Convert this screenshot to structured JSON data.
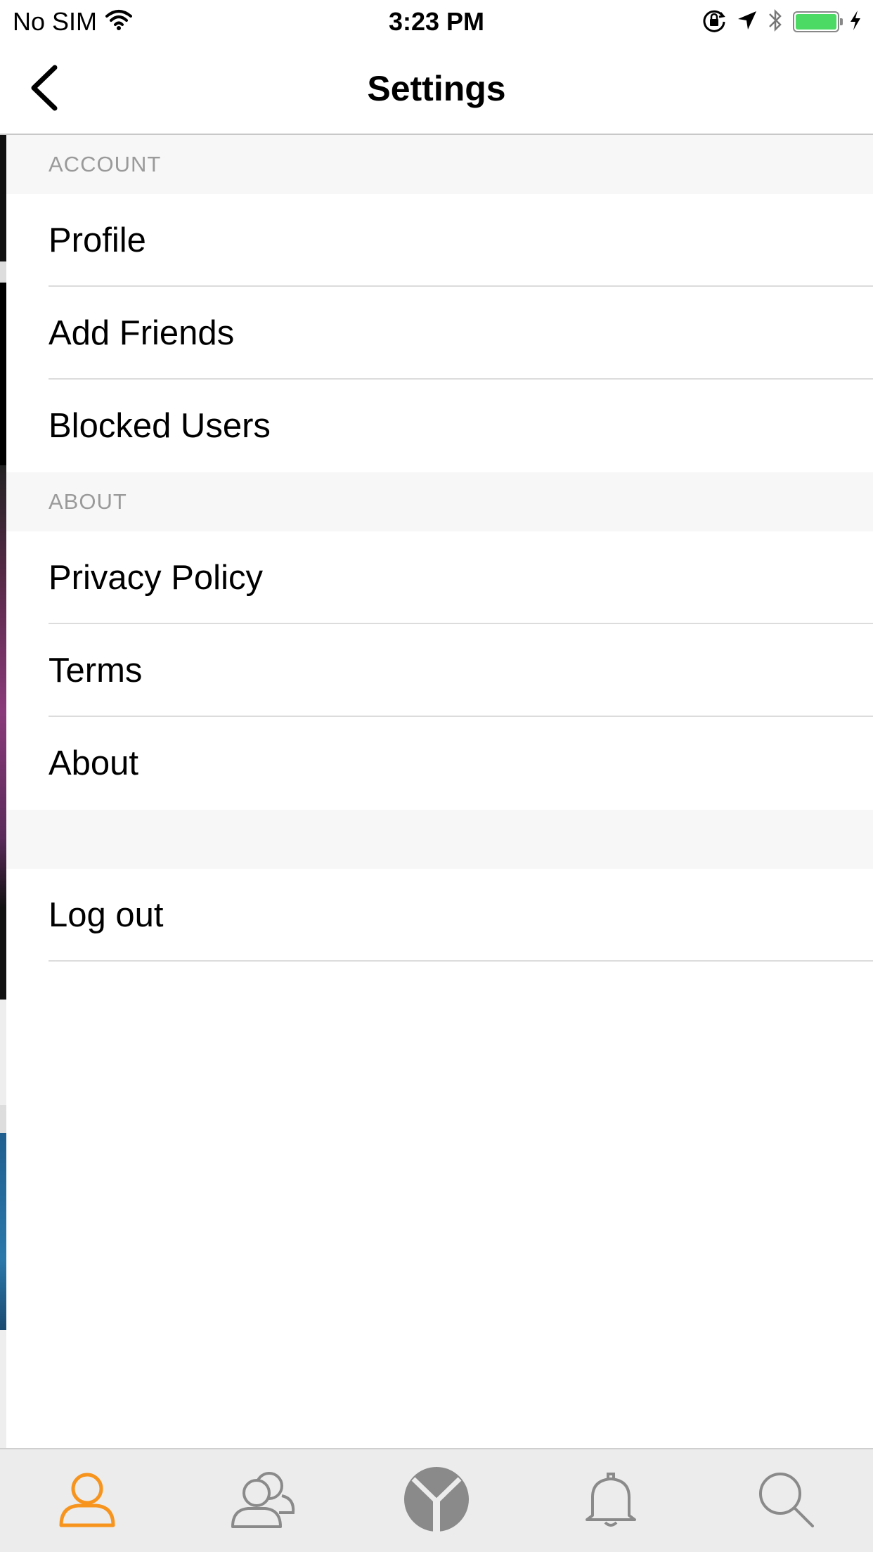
{
  "status_bar": {
    "carrier": "No SIM",
    "time": "3:23 PM",
    "icons": [
      "wifi-icon",
      "orientation-lock-icon",
      "location-arrow-icon",
      "bluetooth-icon",
      "battery-icon",
      "charging-bolt-icon"
    ],
    "battery_level": 1.0
  },
  "navbar": {
    "title": "Settings",
    "back_icon": "chevron-left-icon"
  },
  "sections": {
    "account": {
      "header": "ACCOUNT",
      "items": [
        "Profile",
        "Add Friends",
        "Blocked Users"
      ]
    },
    "about": {
      "header": "ABOUT",
      "items": [
        "Privacy Policy",
        "Terms",
        "About"
      ]
    },
    "session": {
      "items": [
        "Log out"
      ]
    }
  },
  "tab_bar": {
    "tabs": [
      {
        "icon": "profile-icon",
        "active": true
      },
      {
        "icon": "friends-icon",
        "active": false
      },
      {
        "icon": "app-logo-icon",
        "active": false
      },
      {
        "icon": "bell-icon",
        "active": false
      },
      {
        "icon": "search-icon",
        "active": false
      }
    ]
  },
  "colors": {
    "accent": "#f7941d",
    "inactive_icon": "#8a8a8a",
    "section_bg": "#f7f7f7",
    "section_text": "#9a9a9a",
    "battery": "#4cd964"
  }
}
